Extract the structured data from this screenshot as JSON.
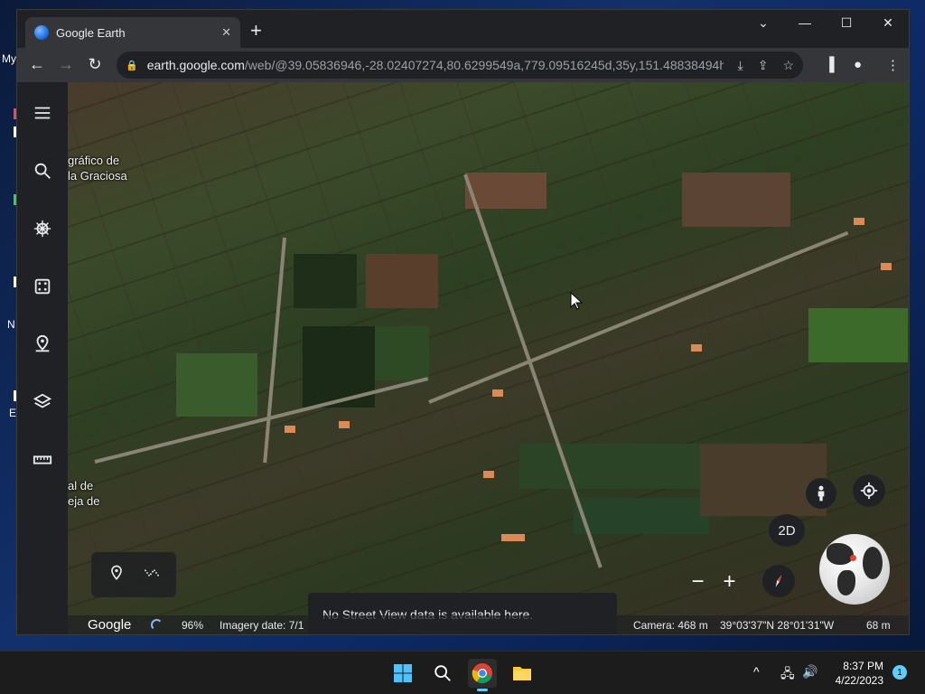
{
  "desktop": {
    "labels": [
      "My",
      "N",
      "E"
    ]
  },
  "browser": {
    "tab_title": "Google Earth",
    "tab_close": "✕",
    "new_tab": "+",
    "window_controls": {
      "dropdown": "⌄",
      "minimize": "—",
      "maximize": "☐",
      "close": "✕"
    },
    "nav": {
      "back": "←",
      "forward": "→",
      "reload": "↻"
    },
    "url_host": "earth.google.com",
    "url_path": "/web/@39.05836946,-28.02407274,80.6299549a,779.09516245d,35y,151.48838494h...",
    "omnibox_icons": [
      "install-icon",
      "share-icon",
      "star-icon"
    ],
    "toolbar_icons": [
      "sidepanel-icon",
      "profile-icon",
      "menu-icon"
    ]
  },
  "earth": {
    "sidebar_items": [
      {
        "name": "menu-icon"
      },
      {
        "name": "search-icon"
      },
      {
        "name": "voyager-icon"
      },
      {
        "name": "feeling-lucky-icon"
      },
      {
        "name": "projects-icon"
      },
      {
        "name": "map-style-icon"
      },
      {
        "name": "measure-icon"
      }
    ],
    "place_label_top": [
      "gráfico de",
      "la Graciosa"
    ],
    "place_label_bottom": [
      "al de",
      "eja de"
    ],
    "btn_2d": "2D",
    "zoom_out": "−",
    "zoom_in": "+",
    "toast": "No Street View data is available here.",
    "status": {
      "logo": "Google",
      "loading": "96%",
      "imagery": "Imagery date: 7/1",
      "camera": "Camera: 468 m",
      "coords": "39°03'37\"N 28°01'31\"W",
      "elevation": "68 m"
    }
  },
  "taskbar": {
    "apps": [
      "start-icon",
      "search-icon",
      "chrome-icon",
      "file-explorer-icon"
    ],
    "tray_chevron": "^",
    "clock_time": "8:37 PM",
    "clock_date": "4/22/2023",
    "notification_count": "1"
  }
}
